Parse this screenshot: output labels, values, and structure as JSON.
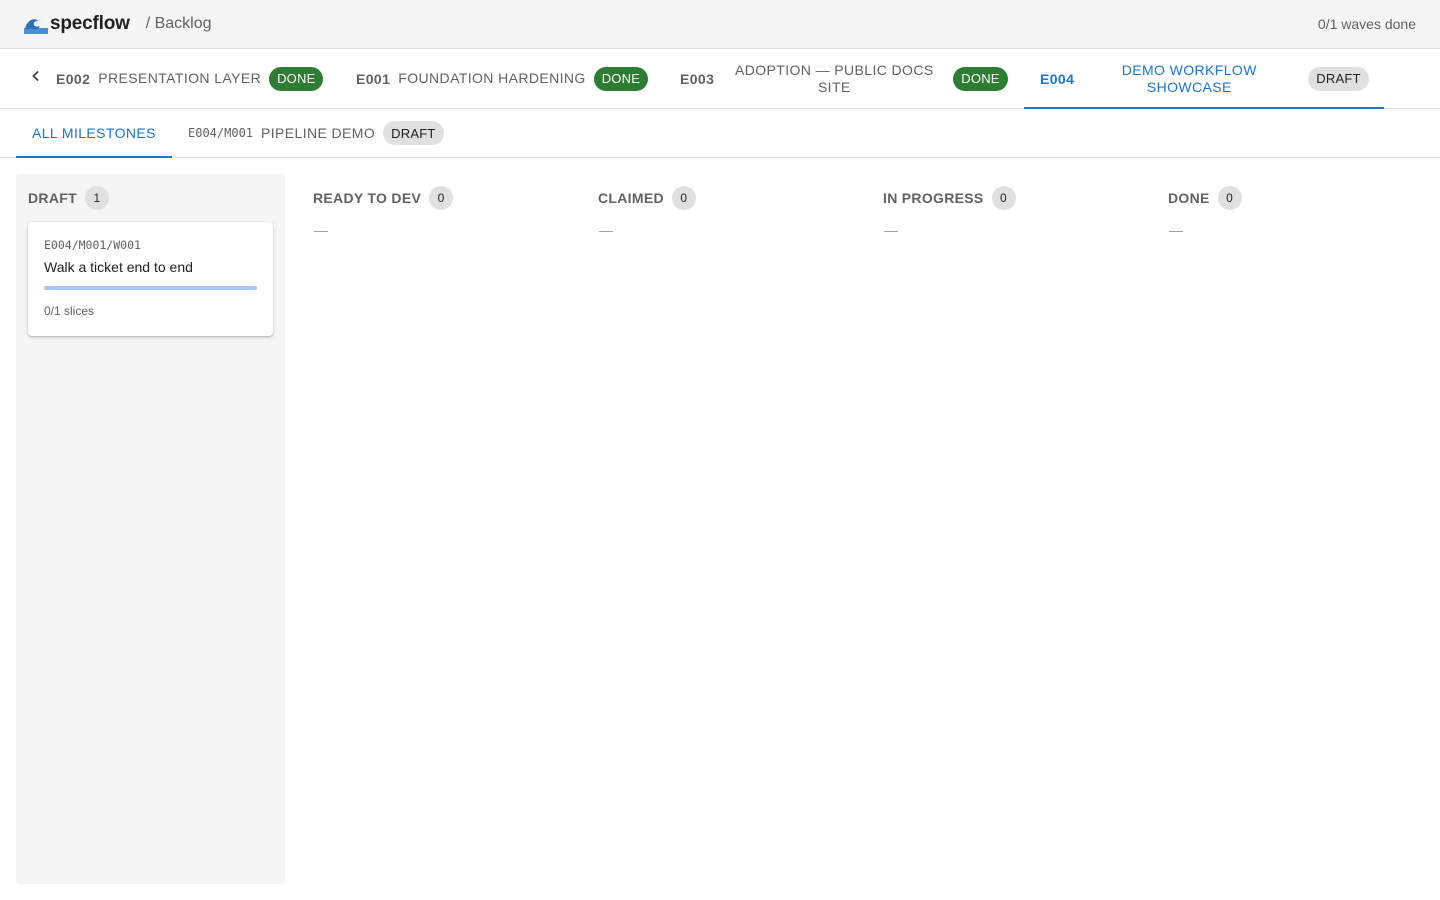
{
  "app": {
    "name": "specflow",
    "logo_icon": "wave-icon",
    "breadcrumb": "/ Backlog",
    "waves_done": "0/1 waves done"
  },
  "epics": [
    {
      "code": "E002",
      "title": "PRESENTATION LAYER",
      "status": "DONE"
    },
    {
      "code": "E001",
      "title": "FOUNDATION HARDENING",
      "status": "DONE"
    },
    {
      "code": "E003",
      "title": "ADOPTION — PUBLIC DOCS SITE",
      "status": "DONE"
    },
    {
      "code": "E004",
      "title": "DEMO WORKFLOW SHOWCASE",
      "status": "DRAFT",
      "active": true
    }
  ],
  "milestones": [
    {
      "label": "ALL MILESTONES",
      "active": true
    },
    {
      "code": "E004/M001",
      "label": "PIPELINE DEMO",
      "status": "DRAFT"
    }
  ],
  "columns": [
    {
      "name": "DRAFT",
      "count": "1"
    },
    {
      "name": "READY TO DEV",
      "count": "0",
      "empty": "—"
    },
    {
      "name": "CLAIMED",
      "count": "0",
      "empty": "—"
    },
    {
      "name": "IN PROGRESS",
      "count": "0",
      "empty": "—"
    },
    {
      "name": "DONE",
      "count": "0",
      "empty": "—"
    }
  ],
  "cards": [
    {
      "id": "E004/M001/W001",
      "title": "Walk a ticket end to end",
      "progress": 0,
      "meta": "0/1 slices"
    }
  ],
  "colors": {
    "accent": "#1976d2",
    "done_chip": "#2e7d32",
    "draft_chip": "#e0e0e0"
  }
}
